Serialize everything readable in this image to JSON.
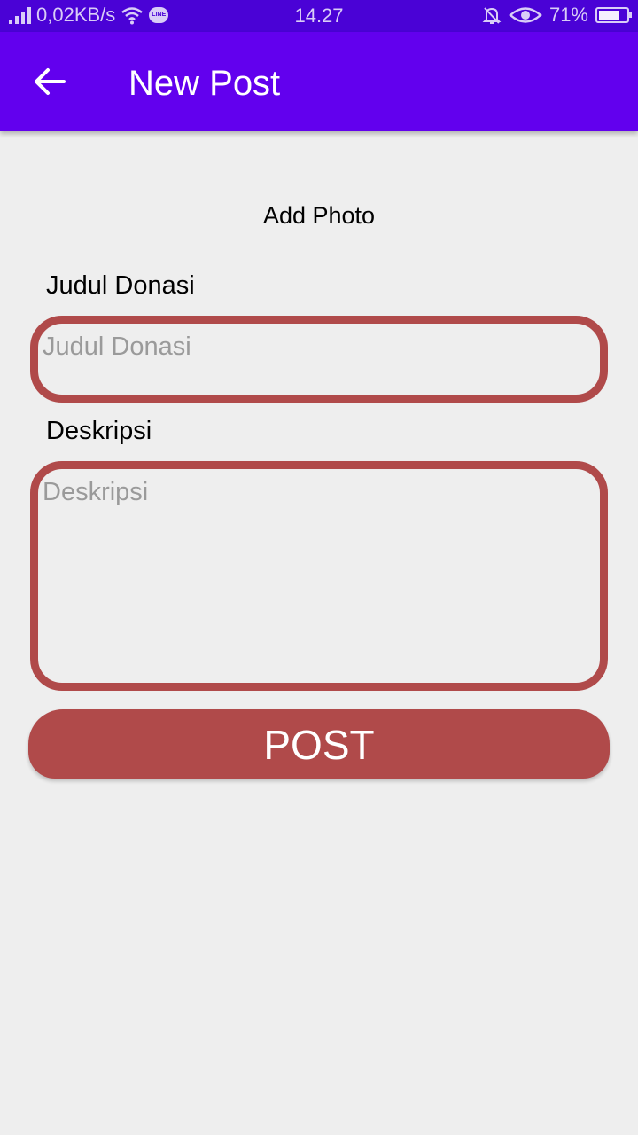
{
  "status_bar": {
    "net_speed": "0,02KB/s",
    "time": "14.27",
    "battery": "71%",
    "line_badge": "LINE",
    "icons": [
      "signal-icon",
      "wifi-icon",
      "line-icon",
      "mute-icon",
      "eye-icon",
      "battery-icon"
    ]
  },
  "app_bar": {
    "title": "New Post",
    "back_icon": "arrow-left-icon"
  },
  "form": {
    "add_photo": "Add Photo",
    "title_label": "Judul Donasi",
    "title_placeholder": "Judul Donasi",
    "desc_label": "Deskripsi",
    "desc_placeholder": "Deskripsi",
    "submit_label": "POST"
  },
  "colors": {
    "status_bar": "#4a02d6",
    "app_bar": "#6200ee",
    "accent": "#b04a4a",
    "background": "#eeeeee"
  }
}
